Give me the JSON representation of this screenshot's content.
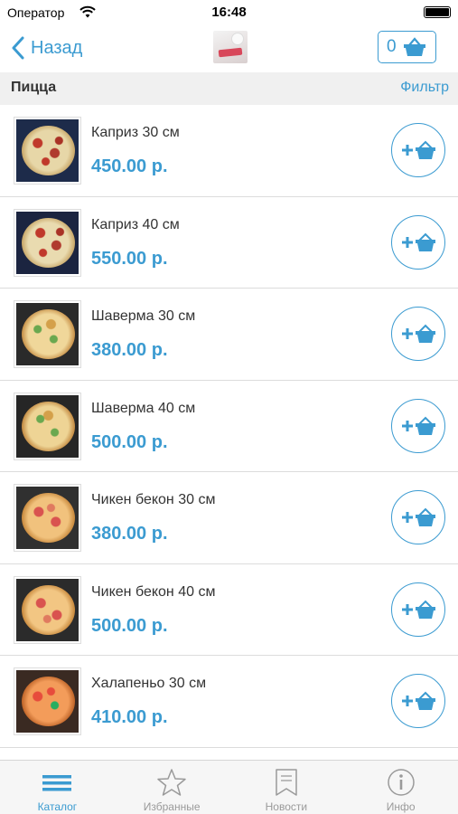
{
  "status_bar": {
    "carrier": "Оператор",
    "time": "16:48"
  },
  "nav": {
    "back_label": "Назад",
    "cart_count": "0"
  },
  "category": {
    "title": "Пицца",
    "filter_label": "Фильтр"
  },
  "products": [
    {
      "name": "Каприз 30 см",
      "price": "450.00 р."
    },
    {
      "name": "Каприз 40 см",
      "price": "550.00 р."
    },
    {
      "name": "Шаверма 30 см",
      "price": "380.00 р."
    },
    {
      "name": "Шаверма 40 см",
      "price": "500.00 р."
    },
    {
      "name": "Чикен бекон 30 см",
      "price": "380.00 р."
    },
    {
      "name": "Чикен бекон 40 см",
      "price": "500.00 р."
    },
    {
      "name": "Халапеньо 30 см",
      "price": "410.00 р."
    },
    {
      "name": "",
      "price": ""
    }
  ],
  "tabs": [
    {
      "label": "Каталог",
      "icon": "list-icon",
      "active": true
    },
    {
      "label": "Избранные",
      "icon": "star-icon",
      "active": false
    },
    {
      "label": "Новости",
      "icon": "bookmark-icon",
      "active": false
    },
    {
      "label": "Инфо",
      "icon": "info-icon",
      "active": false
    }
  ],
  "colors": {
    "accent": "#3b9bd1",
    "category_bar": "#f0f0f0",
    "tab_bar": "#f6f6f6"
  }
}
